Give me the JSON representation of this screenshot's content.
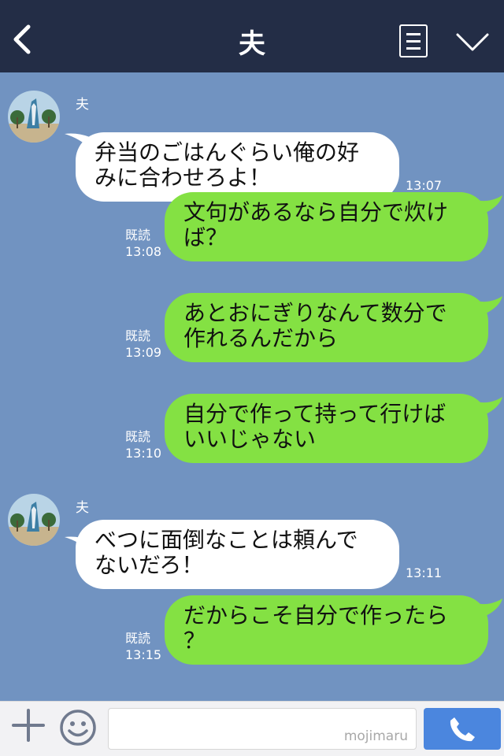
{
  "header": {
    "title": "夫",
    "back_icon": "chevron-left-icon",
    "menu_icon": "list-icon",
    "more_icon": "chevron-down-icon"
  },
  "messages": [
    {
      "side": "in",
      "sender": "夫",
      "lines": [
        "弁当のごはんぐらい俺の好",
        "みに合わせろよ！"
      ],
      "time": "13:07"
    },
    {
      "side": "out",
      "read": "既読",
      "lines": [
        "文句があるなら自分で炊け",
        "ば？"
      ],
      "time": "13:08"
    },
    {
      "side": "out",
      "read": "既読",
      "lines": [
        "あとおにぎりなんて数分で",
        "作れるんだから"
      ],
      "time": "13:09"
    },
    {
      "side": "out",
      "read": "既読",
      "lines": [
        "自分で作って持って行けば",
        "いいじゃない"
      ],
      "time": "13:10"
    },
    {
      "side": "in",
      "sender": "夫",
      "lines": [
        "べつに面倒なことは頼んで",
        "ないだろ！"
      ],
      "time": "13:11"
    },
    {
      "side": "out",
      "read": "既読",
      "lines": [
        "だからこそ自分で作ったら",
        "？"
      ],
      "time": "13:15"
    }
  ],
  "footer": {
    "plus_icon": "plus-icon",
    "emoji_icon": "smiley-icon",
    "input_value": "",
    "watermark": "mojimaru",
    "send_icon": "phone-icon"
  },
  "colors": {
    "header_bg": "#232d46",
    "chat_bg": "#7193c1",
    "bubble_in": "#ffffff",
    "bubble_out": "#84e143",
    "send_button": "#4b86de"
  }
}
